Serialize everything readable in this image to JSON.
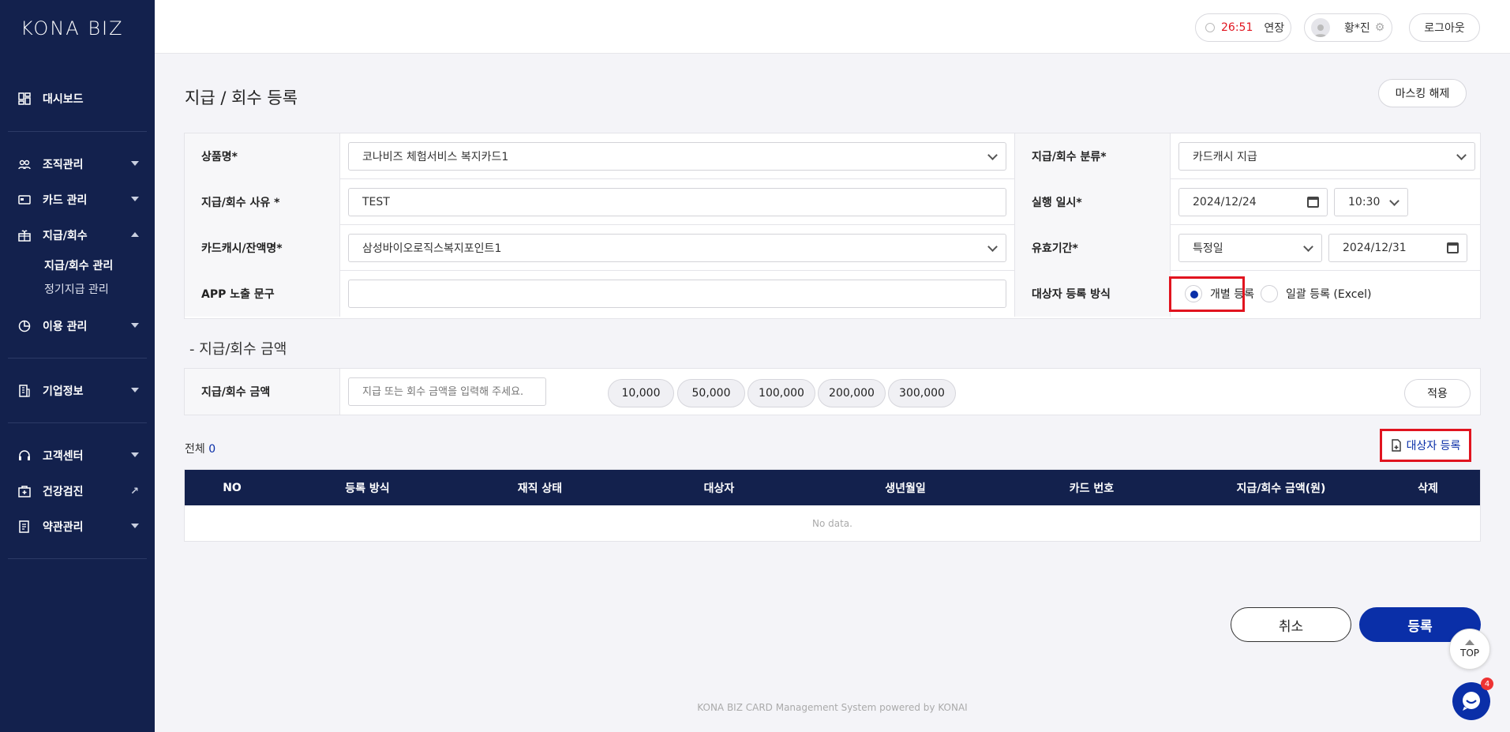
{
  "brand": "KONA BIZ",
  "header": {
    "timer": "26:51",
    "extend_label": "연장",
    "user_name": "황*진",
    "logout_label": "로그아웃"
  },
  "sidebar": {
    "items": [
      {
        "label": "대시보드",
        "icon": "dashboard-icon"
      },
      {
        "label": "조직관리",
        "icon": "people-icon"
      },
      {
        "label": "카드 관리",
        "icon": "card-icon"
      },
      {
        "label": "지급/회수",
        "icon": "gift-icon"
      },
      {
        "label": "이용 관리",
        "icon": "usage-icon"
      },
      {
        "label": "기업정보",
        "icon": "building-icon"
      },
      {
        "label": "고객센터",
        "icon": "headset-icon"
      },
      {
        "label": "건강검진",
        "icon": "health-icon"
      },
      {
        "label": "약관관리",
        "icon": "document-icon"
      }
    ],
    "sub_items": [
      {
        "label": "지급/회수 관리"
      },
      {
        "label": "정기지급 관리"
      }
    ]
  },
  "page": {
    "title": "지급 / 회수 등록",
    "unmask_label": "마스킹 해제"
  },
  "form": {
    "product_label": "상품명*",
    "product_value": "코나비즈 체험서비스 복지카드1",
    "category_label": "지급/회수 분류*",
    "category_value": "카드캐시 지급",
    "reason_label": "지급/회수 사유 *",
    "reason_value": "TEST",
    "exec_label": "실행 일시*",
    "exec_date": "2024/12/24",
    "exec_time": "10:30",
    "cash_label": "카드캐시/잔액명*",
    "cash_value": "삼성바이오로직스복지포인트1",
    "validity_label": "유효기간*",
    "validity_type": "특정일",
    "validity_date": "2024/12/31",
    "app_label": "APP 노출 문구",
    "app_value": "",
    "method_label": "대상자 등록 방식",
    "method_individual": "개별 등록",
    "method_bulk": "일괄 등록 (Excel)"
  },
  "amount": {
    "section_title": "- 지급/회수 금액",
    "label": "지급/회수 금액",
    "placeholder": "지급 또는 회수 금액을 입력해 주세요.",
    "chips": [
      "10,000",
      "50,000",
      "100,000",
      "200,000",
      "300,000"
    ],
    "apply_label": "적용"
  },
  "list": {
    "total_label": "전체",
    "total_count": "0",
    "register_label": "대상자 등록",
    "columns": [
      "NO",
      "등록 방식",
      "재직 상태",
      "대상자",
      "생년월일",
      "카드 번호",
      "지급/회수 금액(원)",
      "삭제"
    ],
    "empty_text": "No data."
  },
  "actions": {
    "cancel": "취소",
    "submit": "등록",
    "top": "TOP",
    "chat_badge": "4"
  },
  "footer": "KONA BIZ CARD Management System powered by KONAI",
  "colors": {
    "navy": "#13214d",
    "accent": "#0a2fa8",
    "highlight": "#e1141f",
    "timer": "#e1141f"
  }
}
